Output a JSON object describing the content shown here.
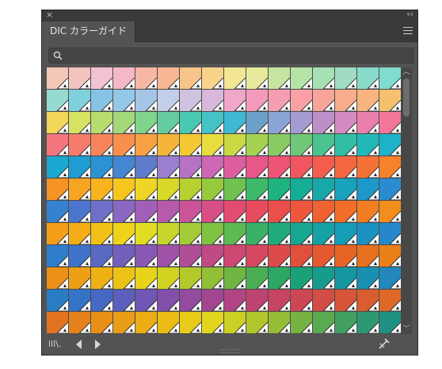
{
  "window": {
    "close_glyph": "×",
    "collapse_glyph": "‹‹"
  },
  "tab": {
    "label": "DIC カラーガイド"
  },
  "menu": {
    "icon": "hamburger-menu-icon"
  },
  "search": {
    "placeholder": "",
    "value": "",
    "icon": "search-icon"
  },
  "footer": {
    "library_icon": "swatch-library-icon",
    "library_glyph": "lll\\.",
    "prev_icon": "previous-library-icon",
    "next_icon": "next-library-icon",
    "tool_icon": "find-field-icon"
  },
  "swatch_colors": [
    [
      "#f4c8b8",
      "#f2c3bf",
      "#f0c2d2",
      "#f5b8c8",
      "#f7b7a5",
      "#f8b793",
      "#f7c48a",
      "#f9d38a",
      "#f3e596",
      "#e6ea9a",
      "#c6e5a0",
      "#b4e3a6",
      "#a6e0b5",
      "#9fdcc3",
      "#86dcc8",
      "#7fdccf"
    ],
    [
      "#96dad2",
      "#7fd1dd",
      "#87c3e5",
      "#93c8e6",
      "#a5c6e6",
      "#c3cee8",
      "#d2c2e2",
      "#d9b8dc",
      "#f0a7c9",
      "#f49aba",
      "#f69eb1",
      "#f8a0a6",
      "#f7a49a",
      "#f7ac8b",
      "#f7b47f",
      "#f6c16f"
    ],
    [
      "#f2d659",
      "#d7e263",
      "#b8dd6e",
      "#a3d77a",
      "#7fd38a",
      "#64cc9e",
      "#49c8b2",
      "#43c3c6",
      "#3fbad2",
      "#6ba0c9",
      "#8aa4d6",
      "#a59bd3",
      "#bd8fc9",
      "#d38bc1",
      "#e97fac",
      "#f27799"
    ],
    [
      "#f4747e",
      "#f67b6c",
      "#f7845a",
      "#f88f4c",
      "#f8a044",
      "#f6b43b",
      "#f4c935",
      "#e9dc3f",
      "#c9d944",
      "#a6d252",
      "#88cb63",
      "#6fc778",
      "#4bc38f",
      "#31bea5",
      "#21b9b8",
      "#1db2c7"
    ],
    [
      "#1aa9d0",
      "#1f9dd3",
      "#2b92d4",
      "#4486d1",
      "#5d7ccc",
      "#9a7fd0",
      "#b772c6",
      "#cc68b5",
      "#dd5ea0",
      "#e8568a",
      "#ee5474",
      "#f15760",
      "#f25d4e",
      "#f36641",
      "#f57236",
      "#f6822c"
    ],
    [
      "#f69326",
      "#f7a422",
      "#f7b41f",
      "#f6c61f",
      "#efd626",
      "#d8d82a",
      "#b7d131",
      "#97c93c",
      "#6fc251",
      "#3dba69",
      "#1db47f",
      "#16ad96",
      "#18a8aa",
      "#18a2bc",
      "#1e98c9",
      "#2a8ccf"
    ],
    [
      "#3582d0",
      "#4c76cd",
      "#6e6fc8",
      "#8a68c2",
      "#a25fb9",
      "#b85aab",
      "#cb5499",
      "#d94f85",
      "#e34c71",
      "#e94b5e",
      "#ec4f4b",
      "#ee573d",
      "#ef6231",
      "#f06e28",
      "#f17e22",
      "#f28e1d"
    ],
    [
      "#f39e19",
      "#f3ae17",
      "#f2c017",
      "#efd21a",
      "#e2dd22",
      "#c6d52a",
      "#a3cb35",
      "#80c241",
      "#5dba52",
      "#39b266",
      "#21ab7b",
      "#17a690",
      "#16a2a4",
      "#169cb5",
      "#1c92c3",
      "#2688cb"
    ],
    [
      "#2f7ecc",
      "#3f73c9",
      "#5a6ac4",
      "#7360bd",
      "#8958b5",
      "#9e52a8",
      "#b14e98",
      "#c14a85",
      "#cd4872",
      "#d6485f",
      "#dd4a4c",
      "#e1503d",
      "#e45930",
      "#e66426",
      "#e8711f",
      "#ea801a"
    ],
    [
      "#ec9016",
      "#eda014",
      "#edb113",
      "#ecc315",
      "#e7d31a",
      "#d1d321",
      "#b3c92a",
      "#91bf35",
      "#6fb642",
      "#4cae52",
      "#2ca764",
      "#1aa178",
      "#169c8c",
      "#16979f",
      "#1a90b0",
      "#2187bd"
    ],
    [
      "#297dc4",
      "#3473c6",
      "#4768c2",
      "#5b5fbb",
      "#6f57b3",
      "#824faa",
      "#934a9f",
      "#a34692",
      "#b14483",
      "#bd4372",
      "#c64462",
      "#cd4753",
      "#d24d45",
      "#d65439",
      "#da5d2f",
      "#de6827"
    ],
    [
      "#e27421",
      "#e5811c",
      "#e88f18",
      "#ea9d16",
      "#ebac15",
      "#ebbb16",
      "#e9ca19",
      "#e2d51e",
      "#cdd024",
      "#b1c62d",
      "#94bc37",
      "#77b343",
      "#5baa51",
      "#419f61",
      "#2d9872",
      "#209083"
    ]
  ]
}
